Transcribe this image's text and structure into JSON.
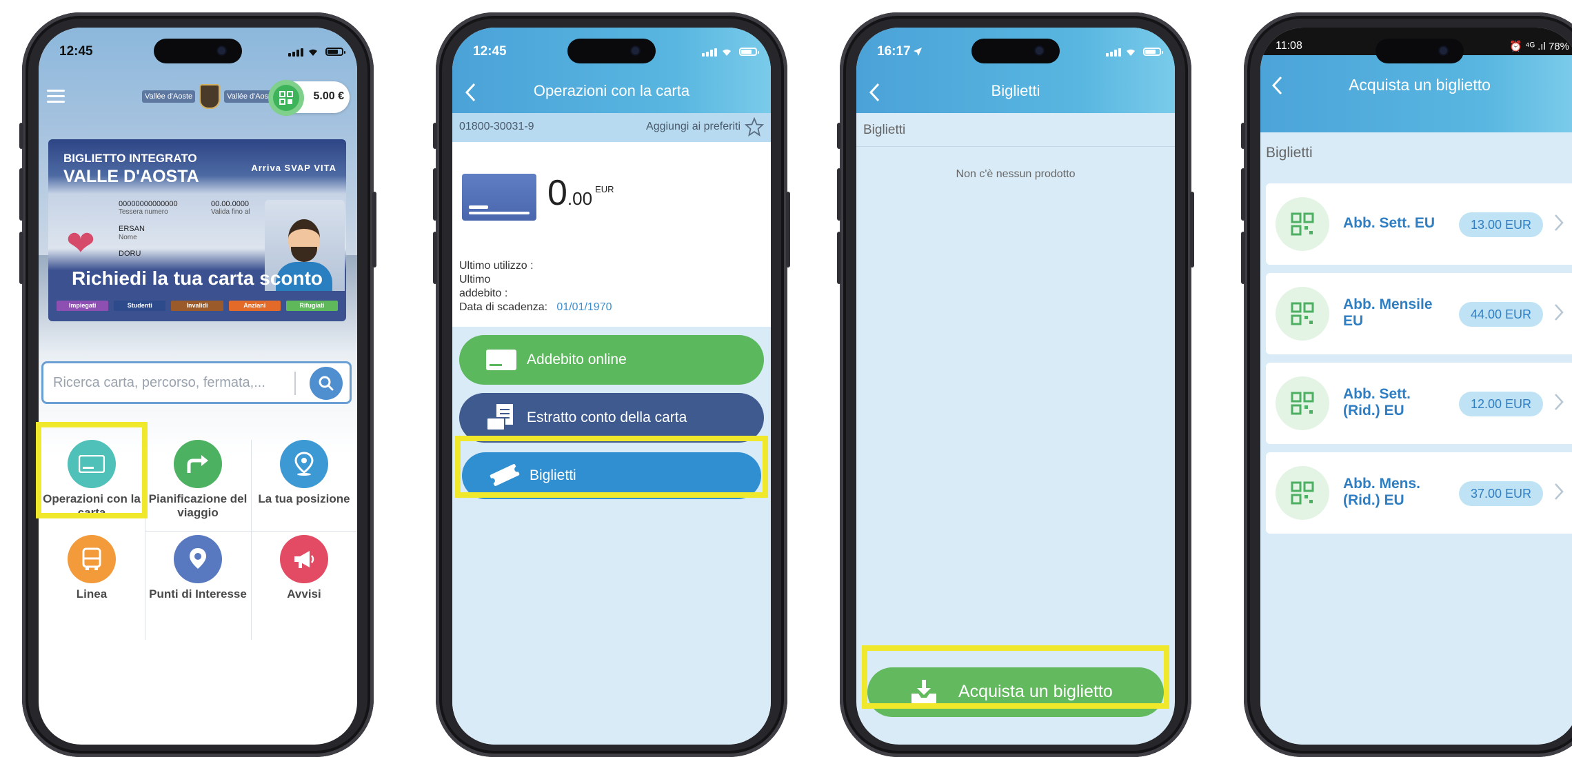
{
  "phone1": {
    "time": "12:45",
    "credit": "5.00 €",
    "logo_left": "Vallée d'Aoste",
    "logo_right": "Vallée d'Aoste",
    "promo": {
      "line1": "BIGLIETTO INTEGRATO",
      "line2": "VALLE D'AOSTA",
      "brands": "Arriva  SVAP  VITA",
      "card_number": "00000000000000",
      "card_number_label": "Tessera numero",
      "valid": "00.00.0000",
      "valid_label": "Valida fino al",
      "name": "ERSAN",
      "name_label": "Nome",
      "surname": "DORU",
      "banner": "Richiedi la tua carta sconto",
      "tags": [
        {
          "label": "Impiegati",
          "color": "#8e4fb3"
        },
        {
          "label": "Studenti",
          "color": "#2d4a8a"
        },
        {
          "label": "Invalidi",
          "color": "#9b5a2a"
        },
        {
          "label": "Anziani",
          "color": "#e36a28"
        },
        {
          "label": "Rifugiati",
          "color": "#5fb85a"
        }
      ]
    },
    "search_placeholder": "Ricerca carta, percorso, fermata,...",
    "tiles": [
      {
        "label": "Operazioni con la carta",
        "icon": "card-icon",
        "color": "#4fc1b9"
      },
      {
        "label": "Pianificazione del viaggio",
        "icon": "route-arrow-icon",
        "color": "#4cb161"
      },
      {
        "label": "La tua posizione",
        "icon": "location-pin-icon",
        "color": "#3d99d4"
      },
      {
        "label": "Linea",
        "icon": "bus-icon",
        "color": "#f39a3b"
      },
      {
        "label": "Punti di Interesse",
        "icon": "camera-pin-icon",
        "color": "#5878c0"
      },
      {
        "label": "Avvisi",
        "icon": "megaphone-icon",
        "color": "#e24b63"
      }
    ]
  },
  "phone2": {
    "time": "12:45",
    "title": "Operazioni con la carta",
    "card_number": "01800-30031-9",
    "favorites": "Aggiungi ai preferiti",
    "balance_int": "0",
    "balance_dec": ".00",
    "currency": "EUR",
    "last_use_label": "Ultimo utilizzo  :",
    "last_charge_label_1": "Ultimo",
    "last_charge_label_2": "addebito       :",
    "expiry_label": "Data di scadenza:",
    "expiry_value": "01/01/1970",
    "actions": [
      {
        "label": "Addebito online",
        "icon": "card-icon",
        "color": "#5cb85c"
      },
      {
        "label": "Estratto conto della carta",
        "icon": "statement-icon",
        "color": "#3f5a8e"
      },
      {
        "label": "Biglietti",
        "icon": "ticket-icon",
        "color": "#2f8fd0"
      }
    ]
  },
  "phone3": {
    "time": "16:17",
    "title": "Biglietti",
    "section": "Biglietti",
    "empty": "Non c'è nessun prodotto",
    "buy_label": "Acquista un biglietto"
  },
  "phone4": {
    "time": "11:08",
    "status_right": "⏰ ⁴ᴳ .ıl 78%",
    "title": "Acquista un biglietto",
    "section": "Biglietti",
    "items": [
      {
        "line1": "Abb. Sett. EU",
        "line2": "",
        "price": "13.00 EUR"
      },
      {
        "line1": "Abb. Mensile",
        "line2": "EU",
        "price": "44.00 EUR"
      },
      {
        "line1": "Abb. Sett.",
        "line2": "(Rid.) EU",
        "price": "12.00 EUR"
      },
      {
        "line1": "Abb. Mens.",
        "line2": "(Rid.) EU",
        "price": "37.00 EUR"
      }
    ]
  },
  "colors": {
    "highlight": "#f0e82a",
    "header_blue": "#4ba2d8",
    "light_blue_bg": "#d8ebf7",
    "green": "#62b95e",
    "frame": "#27262b"
  }
}
